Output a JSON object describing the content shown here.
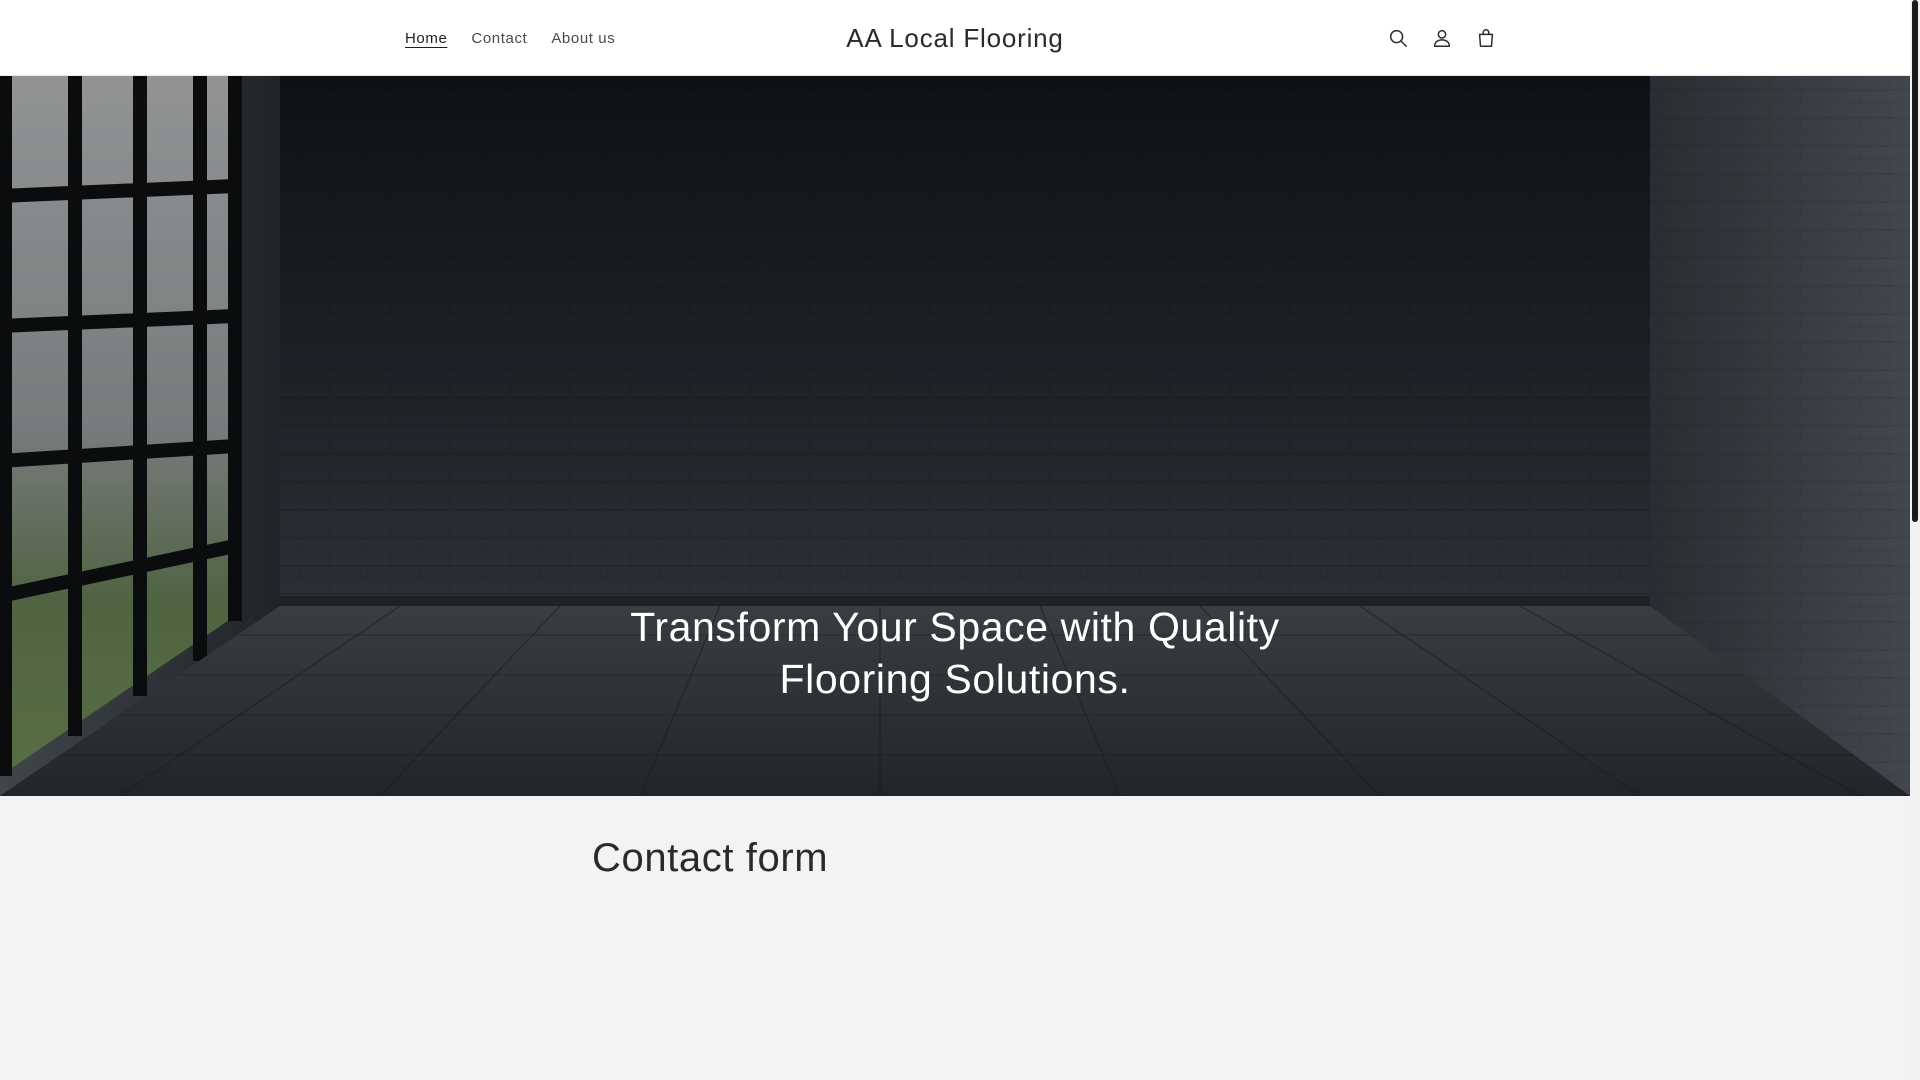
{
  "header": {
    "nav": [
      {
        "label": "Home",
        "active": true
      },
      {
        "label": "Contact",
        "active": false
      },
      {
        "label": "About us",
        "active": false
      }
    ],
    "logo": "AA Local Flooring",
    "icons": [
      "search-icon",
      "account-icon",
      "cart-icon"
    ]
  },
  "hero": {
    "title": "Transform Your Space with Quality Flooring Solutions."
  },
  "contact": {
    "title": "Contact form"
  },
  "colors": {
    "header_bg": "#ffffff",
    "hero_overlay": "#000000",
    "section_bg": "#f3f3f3",
    "text_dark": "#2a2a2a",
    "text_light": "#ffffff"
  },
  "scrollbar": {
    "position_fraction": 0.0
  }
}
